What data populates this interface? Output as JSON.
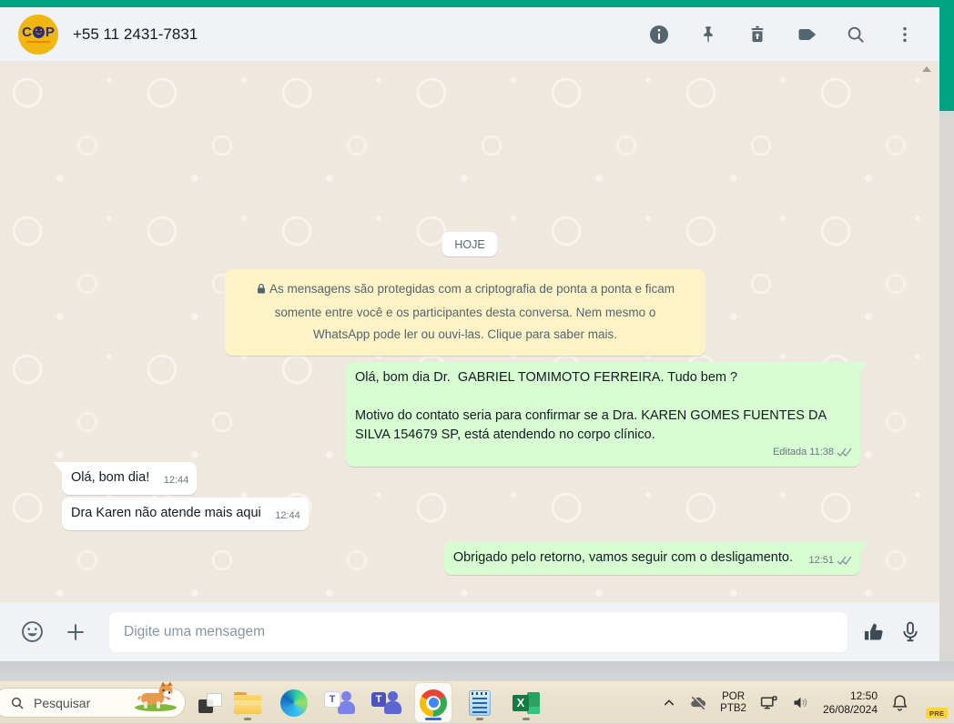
{
  "window": {
    "header": {
      "phone": "+55 11 2431-7831",
      "avatar": {
        "letter_left": "C",
        "letter_right": "P"
      }
    },
    "chat": {
      "date_chip": "HOJE",
      "notice": "As mensagens são protegidas com a criptografia de ponta a ponta e ficam somente entre você e os participantes desta conversa. Nem mesmo o WhatsApp pode ler ou ouvi-las. Clique para saber mais.",
      "messages": [
        {
          "direction": "out",
          "line1": "Olá, bom dia Dr.  GABRIEL TOMIMOTO FERREIRA. Tudo bem ?",
          "line2": "Motivo do contato seria para confirmar se a Dra. KAREN GOMES FUENTES DA SILVA 154679 SP, está atendendo no corpo clínico.",
          "edited_label": "Editada",
          "time": "11:38",
          "status": "delivered"
        },
        {
          "direction": "in",
          "text": "Olá, bom dia!",
          "time": "12:44"
        },
        {
          "direction": "in",
          "text": "Dra Karen não atende mais aqui",
          "time": "12:44"
        },
        {
          "direction": "out",
          "text": "Obrigado pelo retorno, vamos seguir com o desligamento.",
          "time": "12:51",
          "status": "delivered"
        }
      ]
    },
    "composer": {
      "placeholder": "Digite uma mensagem"
    }
  },
  "taskbar": {
    "search_label": "Pesquisar",
    "tray": {
      "lang_line1": "POR",
      "lang_line2": "PTB2",
      "time": "12:50",
      "date": "26/08/2024",
      "copilot_badge": "PRE"
    }
  },
  "colors": {
    "accent_teal": "#00a282",
    "header_bg": "#f0f2f5",
    "chat_bg": "#efe8de",
    "bubble_out": "#d9fdd3",
    "bubble_in": "#ffffff",
    "notice_bg": "#fdf3c7",
    "meta_text": "#667781",
    "icon_gray": "#54656f",
    "taskbar_beige": "#eae2cd"
  }
}
